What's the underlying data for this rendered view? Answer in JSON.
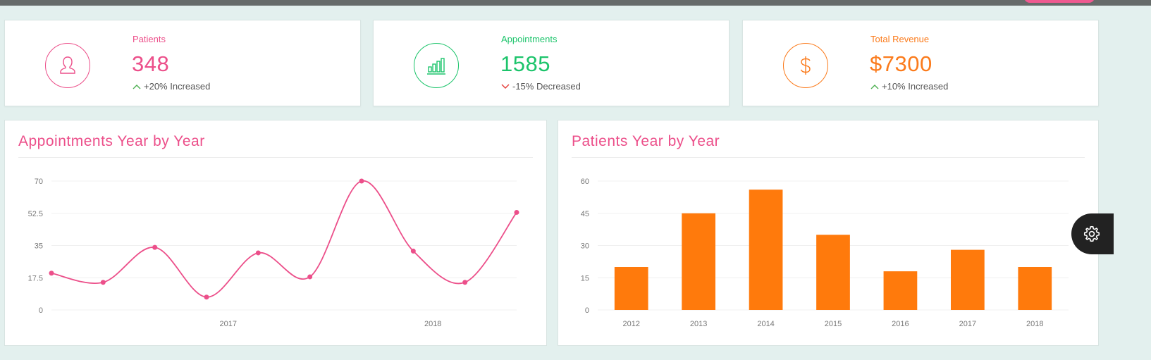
{
  "stats": [
    {
      "label": "Patients",
      "value": "348",
      "trend": "+20% Increased",
      "direction": "up",
      "color": "#ec4f8a",
      "icon": "user-icon"
    },
    {
      "label": "Appointments",
      "value": "1585",
      "trend": "-15% Decreased",
      "direction": "down",
      "color": "#1cc46b",
      "icon": "bar-chart-icon"
    },
    {
      "label": "Total Revenue",
      "value": "$7300",
      "trend": "+10% Increased",
      "direction": "up",
      "color": "#fb7b1c",
      "icon": "dollar-icon"
    }
  ],
  "trend_colors": {
    "up": "#4caf50",
    "down": "#e53935"
  },
  "panels": {
    "appointments_title": "Appointments Year by Year",
    "patients_title": "Patients Year by Year"
  },
  "chart_data": [
    {
      "type": "line",
      "title": "Appointments Year by Year",
      "color": "#ec4f8a",
      "x_tick_labels": [
        "2017",
        "2018"
      ],
      "y_ticks": [
        "0",
        "17.5",
        "35",
        "52.5",
        "70"
      ],
      "ylim": [
        0,
        70
      ],
      "values": [
        20,
        15,
        34,
        7,
        31,
        18,
        70,
        32,
        15,
        53
      ]
    },
    {
      "type": "bar",
      "title": "Patients Year by Year",
      "color": "#ff7a0c",
      "categories": [
        "2012",
        "2013",
        "2014",
        "2015",
        "2016",
        "2017",
        "2018"
      ],
      "values": [
        20,
        45,
        56,
        35,
        18,
        28,
        20
      ],
      "y_ticks": [
        "0",
        "15",
        "30",
        "45",
        "60"
      ],
      "ylim": [
        0,
        60
      ]
    }
  ]
}
